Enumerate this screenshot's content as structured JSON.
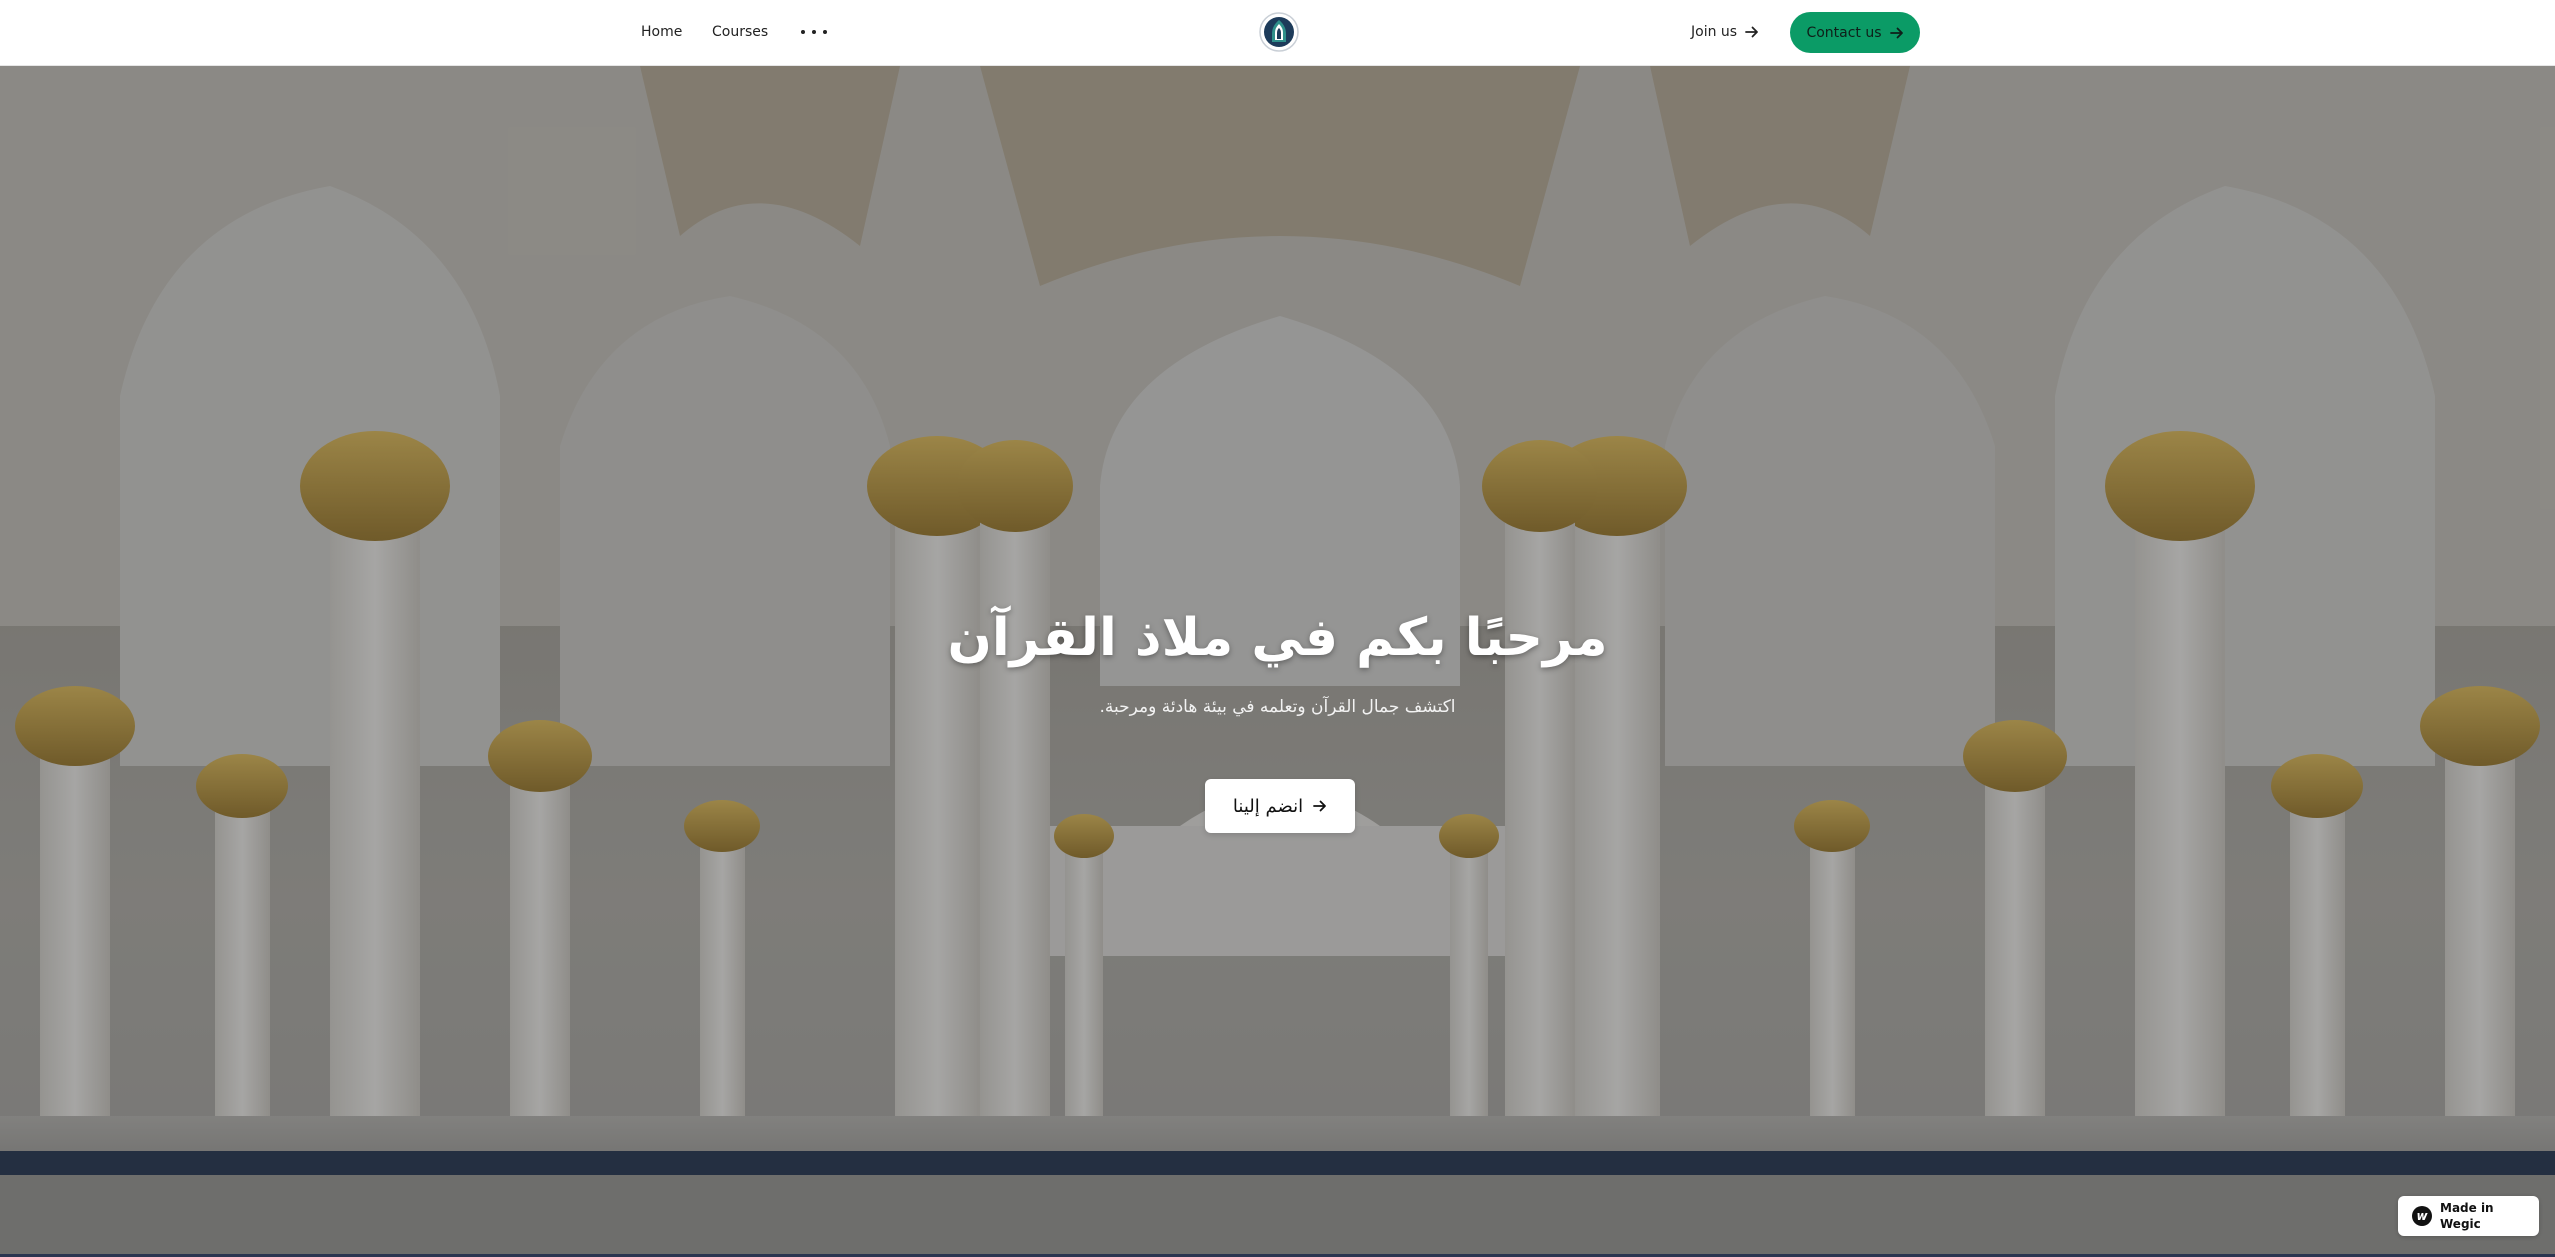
{
  "header": {
    "nav": [
      {
        "label": "Home"
      },
      {
        "label": "Courses"
      }
    ],
    "more_icon": "more-horizontal-icon",
    "logo_icon": "mosque-emblem-icon",
    "join_label": "Join us",
    "contact_label": "Contact us",
    "arrow_icon": "arrow-right-icon",
    "colors": {
      "accent": "#0b9b66",
      "text": "#222222"
    }
  },
  "hero": {
    "title": "مرحبًا بكم في ملاذ القرآن",
    "subtitle": "اكتشف جمال القرآن وتعلمه في بيئة هادئة ومرحبة.",
    "cta_label": "انضم إلينا",
    "background": "mosque-arcade-photo"
  },
  "badge": {
    "text": "Made in Wegic",
    "icon": "wegic-logo-icon"
  }
}
